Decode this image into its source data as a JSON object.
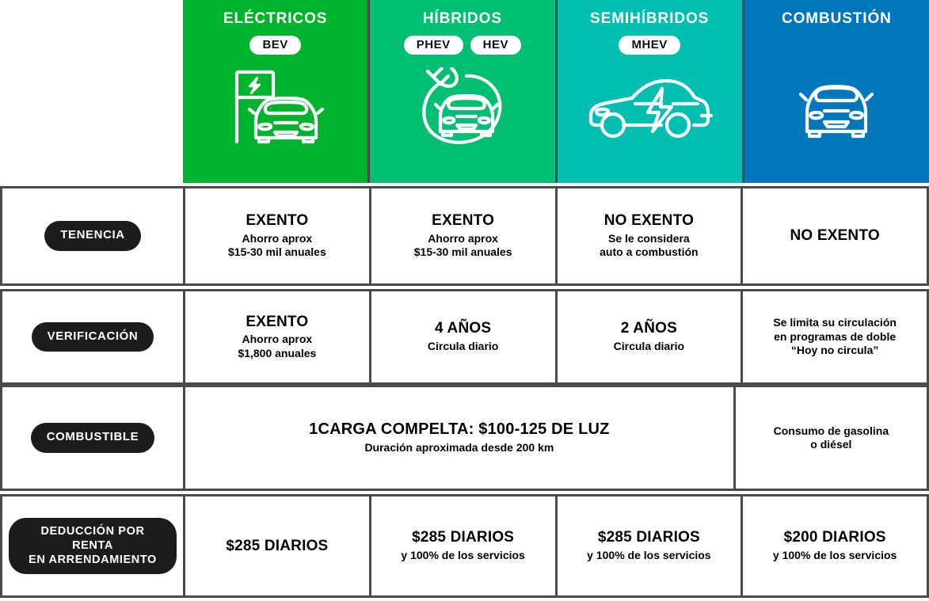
{
  "header": {
    "columns": [
      {
        "title": "ELÉCTRICOS",
        "badges": [
          "BEV"
        ],
        "color": "#00b32c",
        "icon": "charging-station-car-icon"
      },
      {
        "title": "HÍBRIDOS",
        "badges": [
          "PHEV",
          "HEV"
        ],
        "color": "#00bf72",
        "icon": "plug-circle-car-icon"
      },
      {
        "title": "SEMIHÍBRIDOS",
        "badges": [
          "MHEV"
        ],
        "color": "#00bfb0",
        "icon": "car-side-bolt-icon"
      },
      {
        "title": "COMBUSTIÓN",
        "badges": [],
        "color": "#0077bb",
        "icon": "car-front-icon"
      }
    ]
  },
  "rows": [
    {
      "label": "TENENCIA",
      "cells": [
        {
          "main": "EXENTO",
          "sub": [
            "Ahorro aprox",
            "$15-30 mil anuales"
          ]
        },
        {
          "main": "EXENTO",
          "sub": [
            "Ahorro aprox",
            "$15-30 mil anuales"
          ]
        },
        {
          "main": "NO EXENTO",
          "sub": [
            "Se le considera",
            "auto a combustión"
          ]
        },
        {
          "main": "NO EXENTO",
          "sub": []
        }
      ]
    },
    {
      "label": "VERIFICACIÓN",
      "cells": [
        {
          "main": "EXENTO",
          "sub": [
            "Ahorro aprox",
            "$1,800 anuales"
          ]
        },
        {
          "main": "4 AÑOS",
          "sub": [
            "Circula diario"
          ]
        },
        {
          "main": "2 AÑOS",
          "sub": [
            "Circula diario"
          ]
        },
        {
          "main": "",
          "sub": [
            "Se limita su circulación",
            "en programas de doble",
            "“Hoy no circula”"
          ]
        }
      ]
    },
    {
      "label": "COMBUSTIBLE",
      "merged": {
        "main": "1CARGA COMPELTA: $100-125 DE LUZ",
        "sub": [
          "Duración aproximada desde 200 km"
        ]
      },
      "cells": [
        {
          "main": "",
          "sub": [
            "Consumo de gasolina",
            "o diésel"
          ]
        }
      ]
    },
    {
      "label": "DEDUCCIÓN POR RENTA EN ARRENDAMIENTO",
      "label_lines": [
        "DEDUCCIÓN POR RENTA",
        "EN ARRENDAMIENTO"
      ],
      "cells": [
        {
          "main": "$285 DIARIOS",
          "sub": []
        },
        {
          "main": "$285 DIARIOS",
          "sub": [
            "y 100% de los servicios"
          ]
        },
        {
          "main": "$285 DIARIOS",
          "sub": [
            "y 100% de los servicios"
          ]
        },
        {
          "main": "$200 DIARIOS",
          "sub": [
            "y 100% de los servicios"
          ]
        }
      ]
    }
  ],
  "colors": {
    "border": "#4a4a4a",
    "pill_bg": "#1c1c1c",
    "text": "#000000",
    "background": "#ffffff"
  }
}
